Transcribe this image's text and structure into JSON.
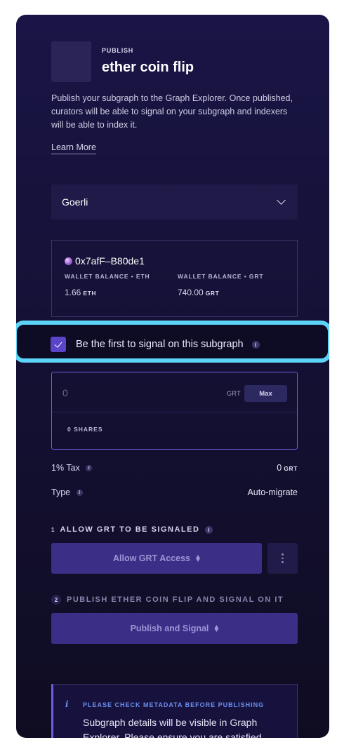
{
  "header": {
    "eyebrow": "PUBLISH",
    "title": "ether coin flip",
    "description": "Publish your subgraph to the Graph Explorer. Once published, curators will be able to signal on your subgraph and indexers will be able to index it.",
    "learn_more": "Learn More"
  },
  "network_select": {
    "value": "Goerli"
  },
  "wallet": {
    "address": "0x7afF–B80de1",
    "eth_label": "WALLET BALANCE • ETH",
    "eth_value": "1.66",
    "eth_unit": "ETH",
    "grt_label": "WALLET BALANCE • GRT",
    "grt_value": "740.00",
    "grt_unit": "GRT"
  },
  "signal_checkbox": {
    "label": "Be the first to signal on this subgraph",
    "checked": true
  },
  "signal_input": {
    "placeholder": "0",
    "unit": "GRT",
    "max_label": "Max",
    "shares": "0 SHARES"
  },
  "summary": {
    "tax_label": "1% Tax",
    "tax_value": "0",
    "tax_unit": "GRT",
    "type_label": "Type",
    "type_value": "Auto-migrate"
  },
  "steps": [
    {
      "num": "1",
      "label": "ALLOW GRT TO BE SIGNALED",
      "button": "Allow GRT Access"
    },
    {
      "num": "2",
      "label": "PUBLISH ETHER COIN FLIP AND SIGNAL ON IT",
      "button": "Publish and Signal"
    }
  ],
  "notice": {
    "title": "PLEASE CHECK METADATA BEFORE PUBLISHING",
    "body": "Subgraph details will be visible in Graph Explorer. Please ensure you are satisfied"
  },
  "colors": {
    "panel_bg": "#1a1546",
    "accent": "#5a44c8",
    "highlight": "#5cd4f7",
    "button_bg": "#3a2e86",
    "notice_accent": "#6b8ff0"
  },
  "icons": [
    "chevron-down-icon",
    "eth-diamond-icon",
    "info-icon",
    "kebab-menu-icon",
    "checkmark-icon",
    "wallet-avatar-icon"
  ]
}
